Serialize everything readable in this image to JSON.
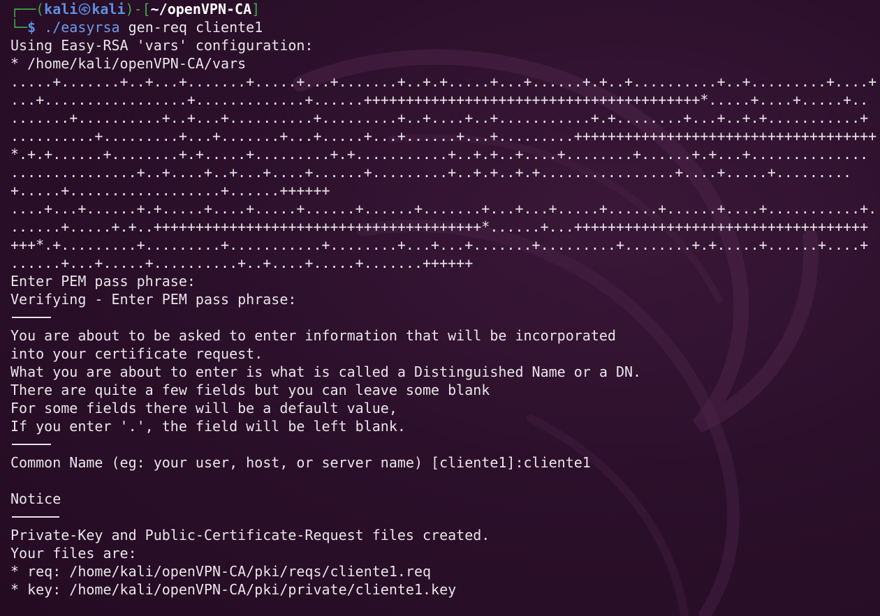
{
  "window": {
    "type": "terminal"
  },
  "prompt": {
    "frame_top": "┌──(",
    "user": "kali",
    "icon": "kali-dragon-icon",
    "host": "kali",
    "frame_mid": ")-[",
    "cwd": "~/openVPN-CA",
    "frame_close": "]",
    "frame_bottom": "└─",
    "symbol": "$",
    "command_exec": "./easyrsa",
    "command_args": "gen-req cliente1"
  },
  "output": {
    "vars_header": "Using Easy-RSA 'vars' configuration:",
    "vars_path": "* /home/kali/openVPN-CA/vars",
    "keygen_1": [
      ".....+.......+..+...+.......+.....+...+.......+..+.+.....+...+......+.+..+..........+..+.........+....+",
      "...+.................+.............+......++++++++++++++++++++++++++++++++++++++++*.....+....+.....+..",
      ".......+..........+..+...+..........+.........+..+....+..+...........+.+........+...+..+.+...........+",
      "..........+.........+...+.......+...+.....+...+......+...+.........+++++++++++++++++++++++++++++++++++++",
      "*.+.+......+........+.+.....+.........+.+...........+..+.+..+....+........+......+.+...+..............",
      "...............+..+....+..+...+....+......+.........+..+.+..+.+................+....+.....+.........",
      "+.....+..................+......++++++"
    ],
    "keygen_2": [
      "....+...+......+.+.....+....+.....+......+......+.......+...+...+.....+......+......+....+...........+.",
      "......+.....+.+..+++++++++++++++++++++++++++++++++++++++*......+...+++++++++++++++++++++++++++++++++++",
      "+++*.+.........+.........+...........+........+...+...+.......+.........+........+.+.....+......+....+",
      "......+...+.....+..........+..+....+.....+.......++++++"
    ],
    "pem_prompt": "Enter PEM pass phrase:",
    "pem_verify": "Verifying - Enter PEM pass phrase:",
    "info_lines": [
      "You are about to be asked to enter information that will be incorporated",
      "into your certificate request.",
      "What you are about to enter is what is called a Distinguished Name or a DN.",
      "There are quite a few fields but you can leave some blank",
      "For some fields there will be a default value,",
      "If you enter '.', the field will be left blank."
    ],
    "common_name_prompt": "Common Name (eg: your user, host, or server name) [cliente1]:cliente1",
    "notice_heading": "Notice",
    "result_lines": [
      "Private-Key and Public-Certificate-Request files created.",
      "Your files are:",
      "* req: /home/kali/openVPN-CA/pki/reqs/cliente1.req",
      "* key: /home/kali/openVPN-CA/pki/private/cliente1.key"
    ]
  }
}
